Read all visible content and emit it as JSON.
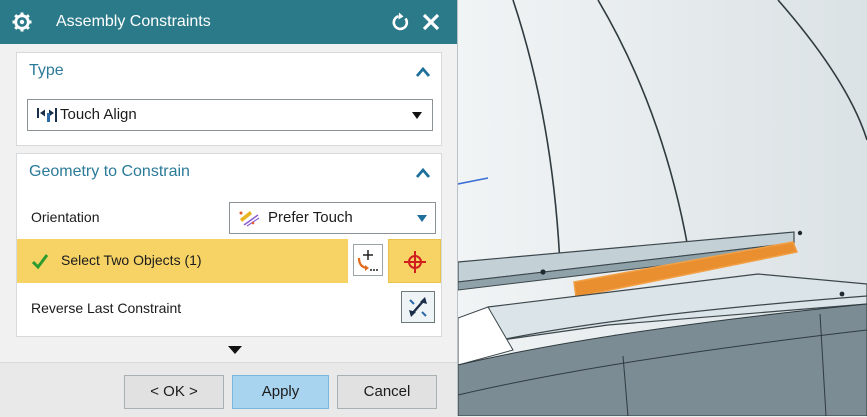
{
  "dialog": {
    "title": "Assembly Constraints",
    "icons": {
      "app": "gear-icon",
      "reset": "reset-icon",
      "close": "close-icon"
    }
  },
  "type_group": {
    "title": "Type",
    "selected": "Touch Align",
    "icon": "touch-align-icon"
  },
  "geometry_group": {
    "title": "Geometry to Constrain",
    "orientation": {
      "label": "Orientation",
      "value": "Prefer Touch",
      "icon": "prefer-touch-icon"
    },
    "select_objects": {
      "label": "Select Two Objects (1)",
      "status": "check-icon"
    },
    "reverse": {
      "label": "Reverse Last Constraint",
      "icon": "reverse-icon"
    }
  },
  "buttons": {
    "ok": "< OK >",
    "apply": "Apply",
    "cancel": "Cancel"
  },
  "colors": {
    "titlebar": "#2b7a89",
    "accent_text": "#2b7a98",
    "selection_highlight": "#f7d366",
    "apply_button": "#a9d4ef",
    "highlighted_edge": "#f19a39"
  }
}
